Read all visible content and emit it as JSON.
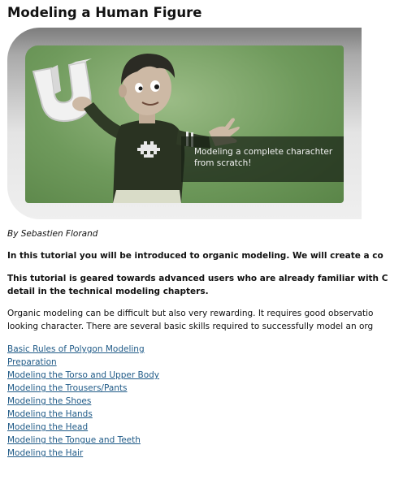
{
  "page": {
    "title": "Modeling a Human Figure"
  },
  "banner": {
    "caption_line1": "Modeling a complete charachter",
    "caption_line2": "from scratch!"
  },
  "author": "By Sebastien Florand",
  "intro": {
    "line1": "In this tutorial you will be introduced to organic modeling. We will create a co"
  },
  "advanced": {
    "line1": "This tutorial is geared towards advanced users who are already familiar with C",
    "line2": "detail in the technical modeling chapters."
  },
  "organic": {
    "line1": "Organic modeling can be difficult but also very rewarding. It requires good observatio",
    "line2": "looking character. There are several basic skills required to successfully model an org"
  },
  "toc": [
    {
      "label": "Basic Rules of Polygon Modeling"
    },
    {
      "label": "Preparation"
    },
    {
      "label": "Modeling the Torso and Upper Body"
    },
    {
      "label": "Modeling the Trousers/Pants"
    },
    {
      "label": "Modeling the Shoes"
    },
    {
      "label": "Modeling the Hands"
    },
    {
      "label": "Modeling the Head"
    },
    {
      "label": "Modeling the Tongue and Teeth"
    },
    {
      "label": "Modeling the Hair"
    }
  ],
  "colors": {
    "link": "#1f5a87",
    "banner_green": "#6f9a5c",
    "caption_bg": "#1c2718"
  }
}
